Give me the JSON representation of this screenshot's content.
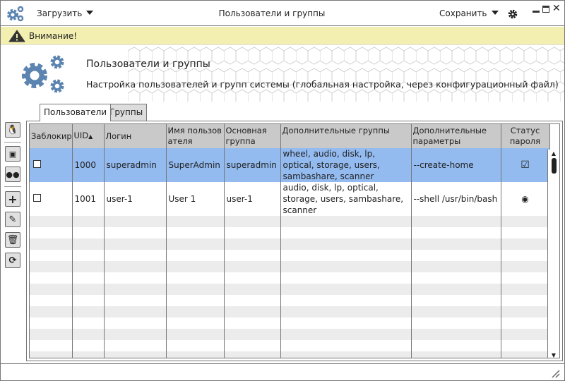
{
  "titlebar": {
    "load_label": "Загрузить",
    "title": "Пользователи и группы",
    "save_label": "Сохранить"
  },
  "warning": {
    "text": "Внимание!"
  },
  "header": {
    "title": "Пользователи и группы",
    "subtitle": "Настройка пользователей и групп системы (глобальная настройка, через конфигурационный файл)"
  },
  "tabs": [
    {
      "label": "Пользователи",
      "active": true
    },
    {
      "label": "Группы",
      "active": false
    }
  ],
  "toolbar": [
    "penguin-icon",
    "user-card-icon",
    "users-group-icon",
    "plus-icon",
    "edit-icon",
    "trash-icon",
    "refresh-icon"
  ],
  "table": {
    "columns": [
      "Заблокир",
      "UID",
      "Логин",
      "Имя пользователя",
      "Основная группа",
      "Дополнительные группы",
      "Дополнительные параметры",
      "Статус пароля"
    ],
    "sort": {
      "column": "UID",
      "direction": "asc"
    },
    "rows": [
      {
        "locked": false,
        "uid": "1000",
        "login": "superadmin",
        "name": "SuperAdmin",
        "group": "superadmin",
        "groups": "wheel, audio, disk, lp, optical, storage, users, sambashare, scanner",
        "params": "--create-home",
        "password_status": "checked",
        "selected": true
      },
      {
        "locked": false,
        "uid": "1001",
        "login": "user-1",
        "name": "User 1",
        "group": "user-1",
        "groups": "audio, disk, lp, optical, storage, users, sambashare, scanner",
        "params": "--shell /usr/bin/bash",
        "password_status": "radio",
        "selected": false
      }
    ]
  },
  "colors": {
    "accent": "#5b84b1",
    "selection": "#93bbf0",
    "warning_bg": "#f3efb0"
  }
}
